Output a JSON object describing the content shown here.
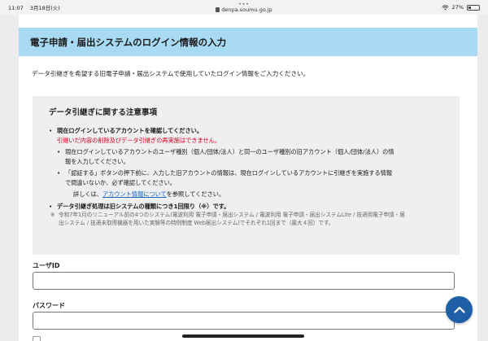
{
  "status_bar": {
    "time": "11:07",
    "date": "3月18日(火)",
    "url": "denpa.soumu.go.jp",
    "battery": "27%"
  },
  "page": {
    "title": "電子申請・届出システムのログイン情報の入力",
    "intro": "データ引継ぎを希望する旧電子申請・届出システムで使用していたログイン情報をご入力ください。",
    "notice": {
      "heading": "データ引継ぎに関する注意事項",
      "item1": "現在ログインしているアカウントを確認してください。",
      "warning": "引継いだ内容の削除及びデータ引継ぎの再実施はできません。",
      "sub1_line1": "現在ログインしているアカウントのユーザ種別（個人/団体/法人）と同一のユーザ種別の旧アカウント（個人/団体/法人）の情",
      "sub1_line2": "報を入力してください。",
      "sub2_line1": "「認証する」ボタンの押下前に、入力した旧アカウントの情報は、現在ログインしているアカウントに引継ぎを実施する情報",
      "sub2_line2": "で間違いないか、必ず確認してください。",
      "detail_prefix": "詳しくは、",
      "detail_link": "アカウント情報について",
      "detail_suffix": "を参照してください。",
      "item2": "データ引継ぎ処理は旧システムの種類につき1回限り（※）です。",
      "footnote_line1": "令和7年1月のリニューアル前の4つのシステム(電波利用 電子申請・届出システム / 電波利用 電子申請・届出システムLite / 技適用電子申請・届",
      "footnote_line2": "出システム / 技適未取得機器を用いた実験等の特例制度 Web届出システム)でそれぞれ1回まで（最大４回）です。"
    },
    "form": {
      "user_id_label": "ユーザID",
      "user_id_value": "",
      "password_label": "パスワード",
      "password_value": ""
    }
  },
  "colors": {
    "header_band": "#a9daf3",
    "warning": "#d0021b",
    "link": "#1565c0",
    "fab": "#1f5fa8"
  }
}
